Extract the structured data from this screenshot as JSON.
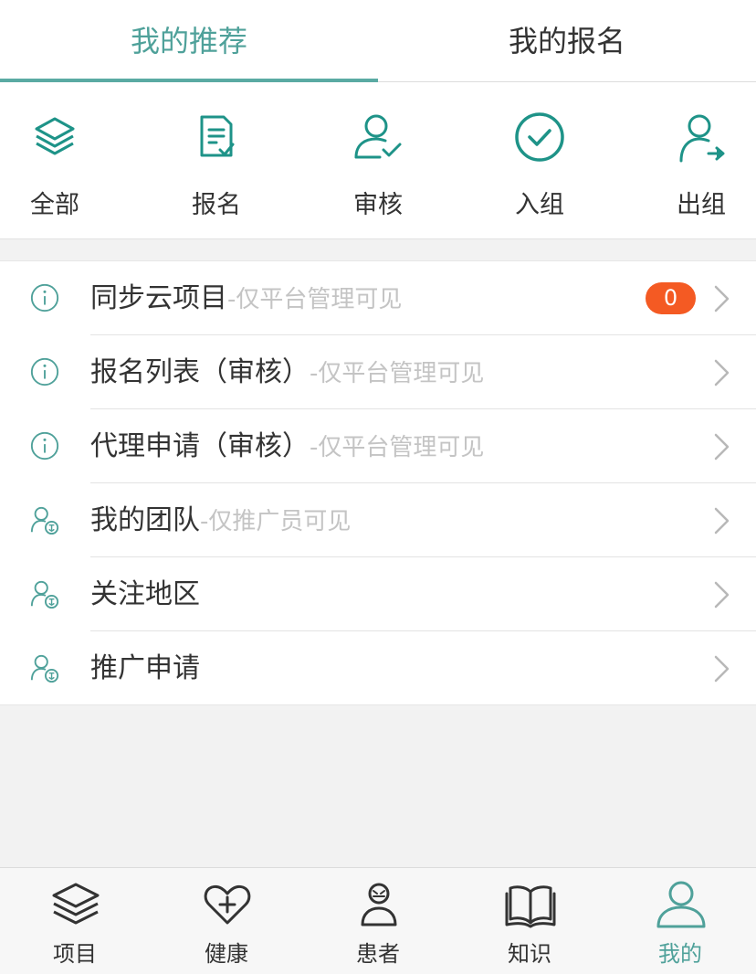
{
  "tabs": [
    {
      "label": "我的推荐",
      "active": true
    },
    {
      "label": "我的报名",
      "active": false
    }
  ],
  "quick_actions": [
    {
      "label": "全部",
      "icon": "layers-icon"
    },
    {
      "label": "报名",
      "icon": "document-check-icon"
    },
    {
      "label": "审核",
      "icon": "user-check-icon"
    },
    {
      "label": "入组",
      "icon": "circle-check-icon"
    },
    {
      "label": "出组",
      "icon": "user-arrow-icon"
    }
  ],
  "menu": [
    {
      "title": "同步云项目",
      "hint": "-仅平台管理可见",
      "icon": "info-icon",
      "badge": "0"
    },
    {
      "title": "报名列表（审核）",
      "hint": "-仅平台管理可见",
      "icon": "info-icon"
    },
    {
      "title": "代理申请（审核）",
      "hint": "-仅平台管理可见",
      "icon": "info-icon"
    },
    {
      "title": "我的团队",
      "hint": "-仅推广员可见",
      "icon": "agent-user-icon"
    },
    {
      "title": "关注地区",
      "hint": "",
      "icon": "agent-user-icon"
    },
    {
      "title": "推广申请",
      "hint": "",
      "icon": "agent-user-icon"
    }
  ],
  "tabbar": [
    {
      "label": "项目",
      "icon": "layers-icon",
      "active": false
    },
    {
      "label": "健康",
      "icon": "heart-plus-icon",
      "active": false
    },
    {
      "label": "患者",
      "icon": "patient-icon",
      "active": false
    },
    {
      "label": "知识",
      "icon": "book-icon",
      "active": false
    },
    {
      "label": "我的",
      "icon": "user-icon",
      "active": true
    }
  ],
  "colors": {
    "accent": "#4fa19a",
    "icon_teal": "#1e9388",
    "badge": "#f45a23",
    "hint": "#c4c4c4"
  }
}
